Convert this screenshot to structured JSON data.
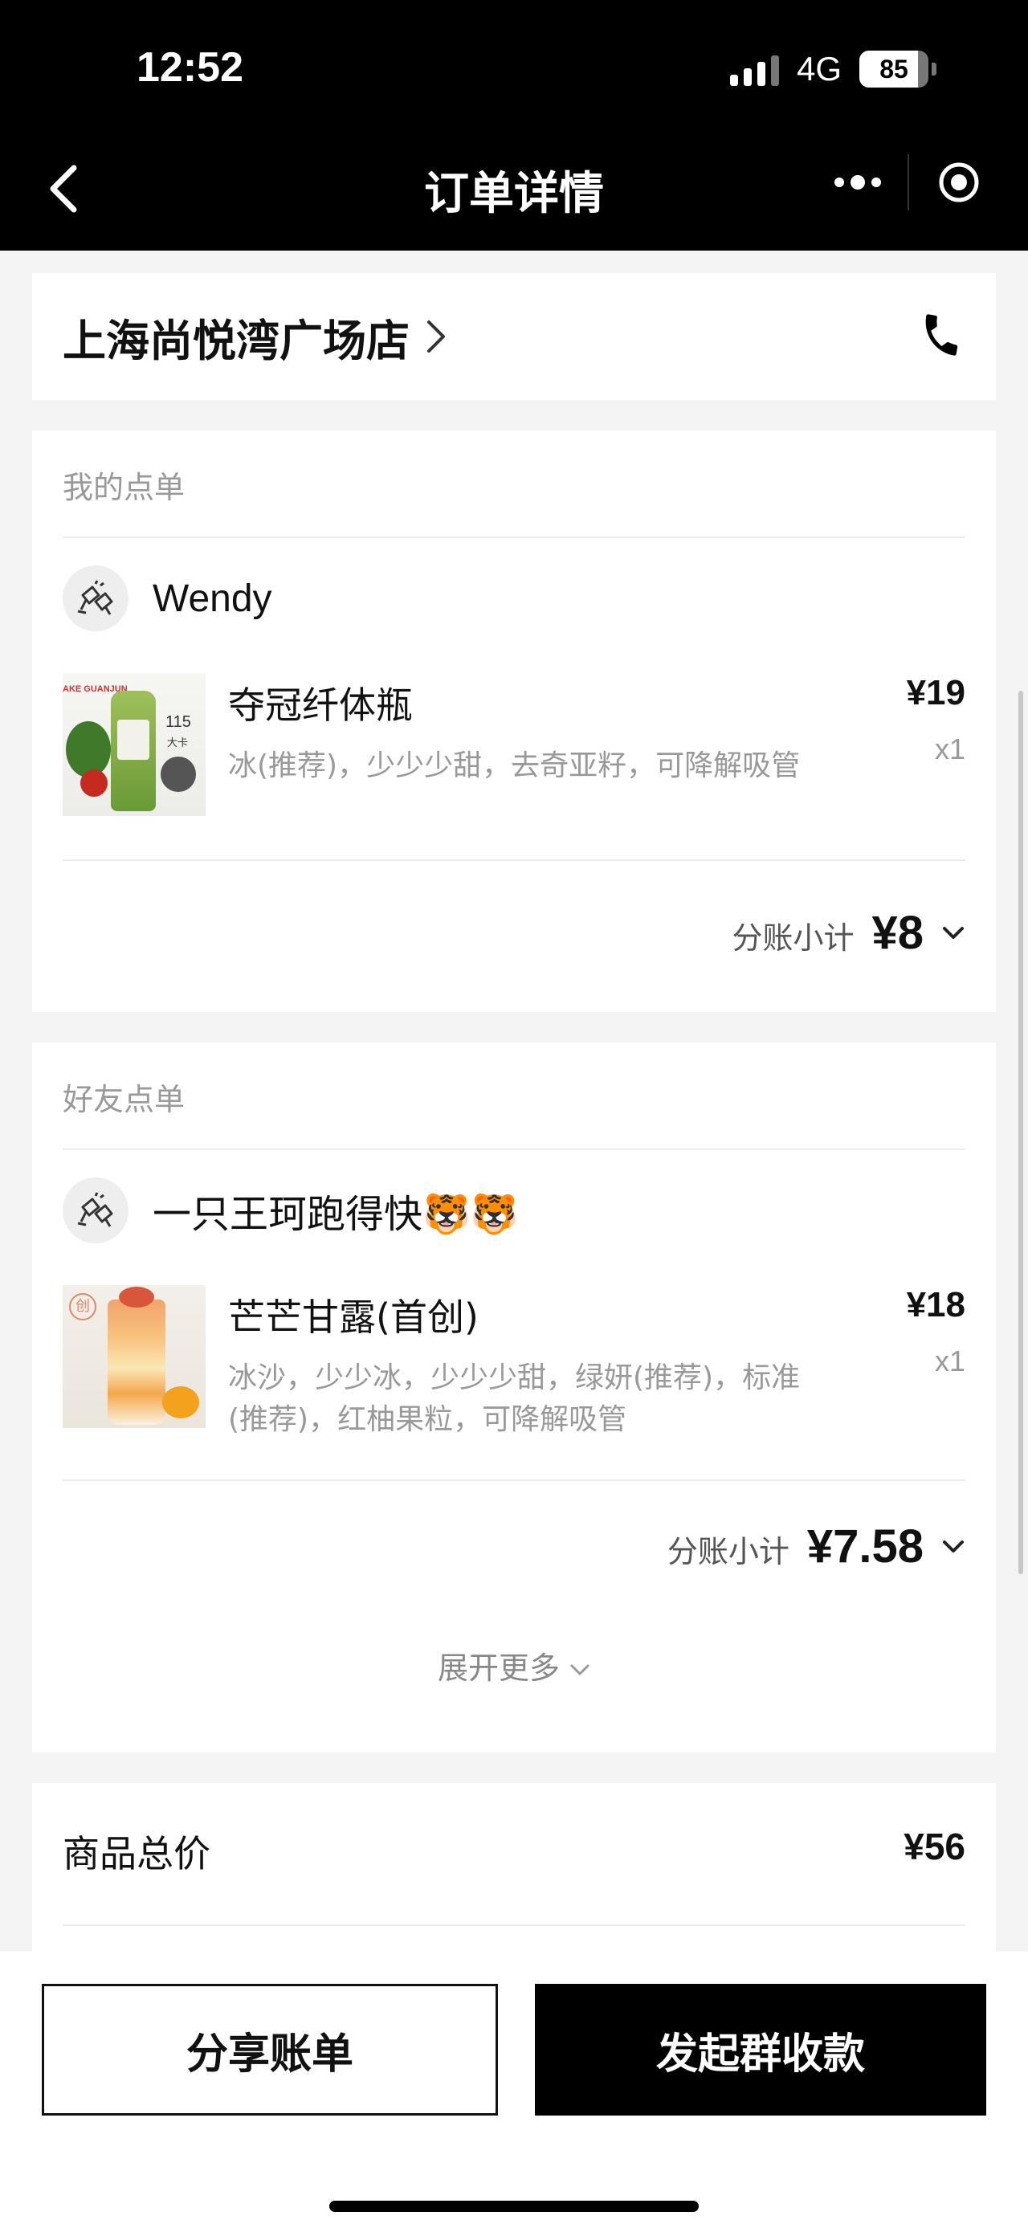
{
  "status_bar": {
    "time": "12:52",
    "network": "4G",
    "battery": "85",
    "battery_level": 0.85
  },
  "nav": {
    "title": "订单详情",
    "back_icon": "chevron-left-icon",
    "more_icon": "more-dots-icon",
    "close_icon": "target-circle-icon"
  },
  "store": {
    "name": "上海尚悦湾广场店",
    "chevron_icon": "chevron-right-icon",
    "phone_icon": "phone-icon"
  },
  "my_order": {
    "label": "我的点单",
    "user": {
      "name": "Wendy",
      "avatar_icon": "cheers-icon"
    },
    "items": [
      {
        "name": "夺冠纤体瓶",
        "options": "冰(推荐)，少少少甜，去奇亚籽，可降解吸管",
        "price": "¥19",
        "qty": "x1",
        "thumb_text": [
          "AKE GUANJUN",
          "115",
          "大卡"
        ]
      }
    ],
    "subtotal_label": "分账小计",
    "subtotal_value": "¥8"
  },
  "friend_order": {
    "label": "好友点单",
    "user": {
      "name": "一只王珂跑得快🐯🐯",
      "avatar_icon": "cheers-icon"
    },
    "items": [
      {
        "name": "芒芒甘露(首创)",
        "options": "冰沙，少少冰，少少少甜，绿妍(推荐)，标准(推荐)，红柚果粒，可降解吸管",
        "price": "¥18",
        "qty": "x1",
        "thumb_text": [
          "创"
        ]
      }
    ],
    "subtotal_label": "分账小计",
    "subtotal_value": "¥7.58",
    "expand_label": "展开更多"
  },
  "summary": {
    "total_label": "商品总价",
    "total_value": "¥56"
  },
  "actions": {
    "share_label": "分享账单",
    "collect_label": "发起群收款"
  },
  "colors": {
    "header_bg": "#000000",
    "page_bg": "#f4f4f4",
    "card_bg": "#ffffff",
    "muted_text": "#999999",
    "primary_button": "#000000"
  }
}
